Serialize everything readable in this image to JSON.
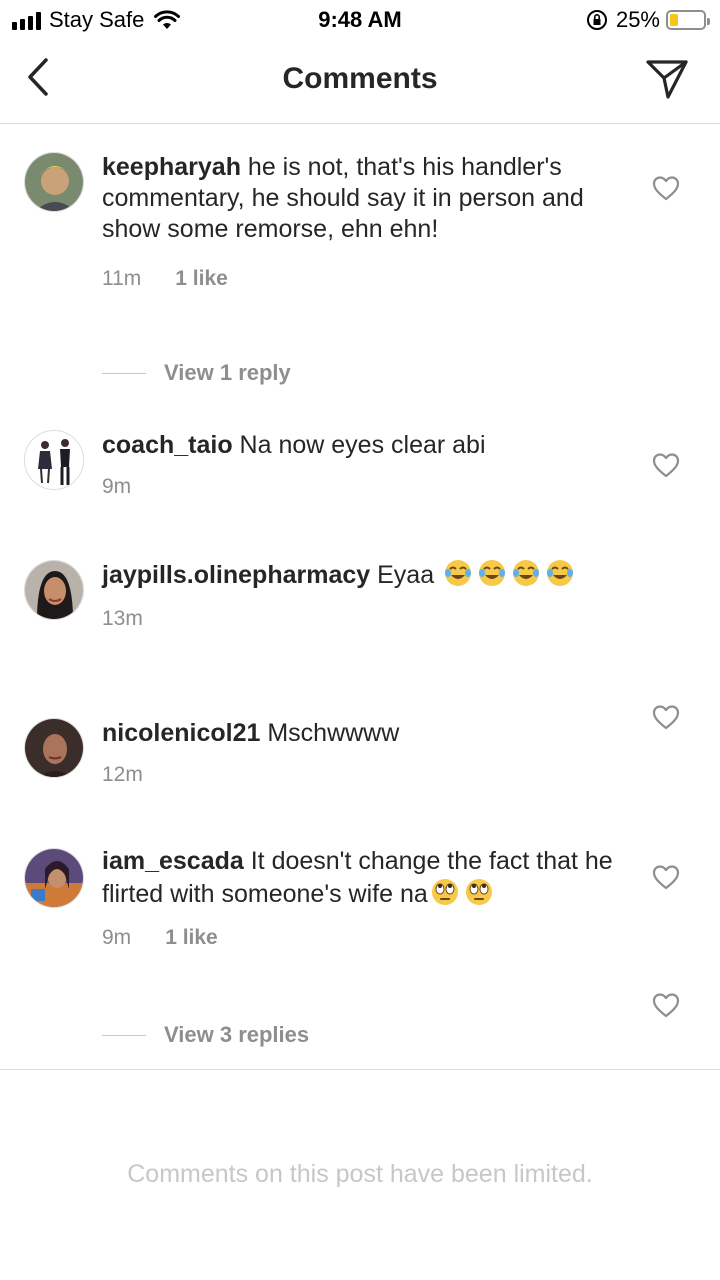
{
  "status_bar": {
    "carrier": "Stay Safe",
    "time": "9:48 AM",
    "battery": "25%",
    "battery_level": 0.25,
    "icons": [
      "signal-icon",
      "wifi-icon",
      "rotation-lock-icon",
      "battery-icon"
    ]
  },
  "header": {
    "title": "Comments",
    "icons": [
      "back-arrow-icon",
      "send-direct-icon"
    ]
  },
  "comments": [
    {
      "username": "keepharyah",
      "text": " he is not, that's his handler's commentary, he should say it in person and show some remorse, ehn ehn!",
      "time": "11m",
      "likes": "1 like",
      "replies": "View 1 reply"
    },
    {
      "username": "coach_taio",
      "text": " Na now eyes clear abi",
      "time": "9m"
    },
    {
      "username": "jaypills.olinepharmacy",
      "text": " Eyaa ",
      "emoji": "face-with-tears-of-joy",
      "time": "13m"
    },
    {
      "username": "nicolenicol21",
      "text": " Mschwwww",
      "time": "12m"
    },
    {
      "username": "iam_escada",
      "text": " It doesn't change the fact that he flirted with someone's wife na",
      "emoji": "face-with-rolling-eyes",
      "time": "9m",
      "likes": "1 like",
      "replies": "View 3 replies"
    }
  ],
  "footer": {
    "limited_text": "Comments on this post have been limited."
  },
  "colors": {
    "text": "#262626",
    "secondary": "#8e8e8e",
    "divider": "#dbdbdb",
    "battery": "#f5c518"
  }
}
